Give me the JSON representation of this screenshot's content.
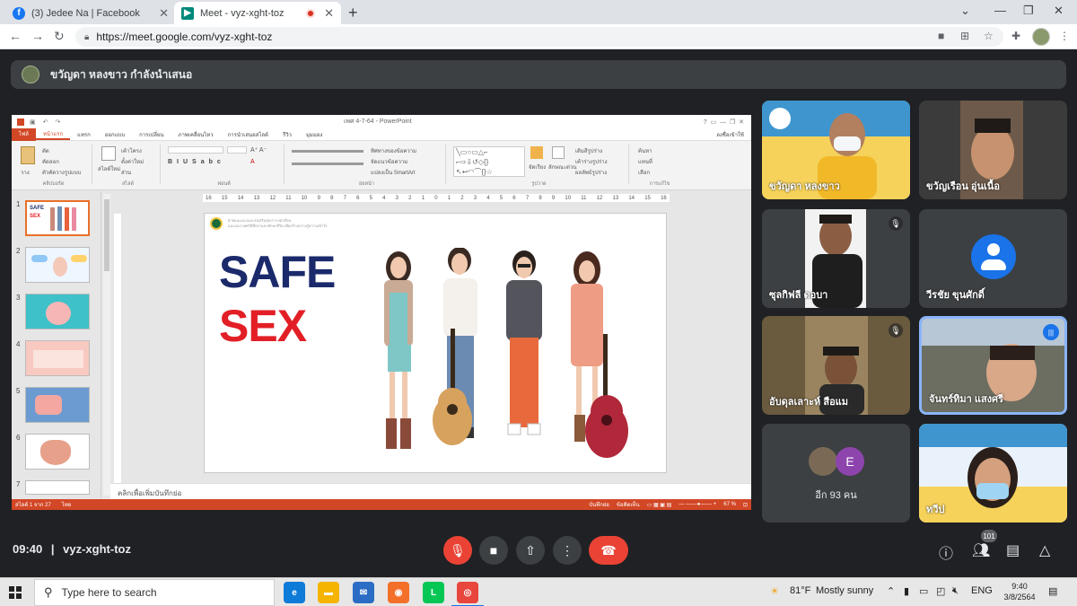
{
  "browser": {
    "tabs": [
      {
        "label": "(3) Jedee Na | Facebook",
        "favicon": "facebook-icon",
        "color": "#1877f2"
      },
      {
        "label": "Meet - vyz-xght-toz",
        "favicon": "meet-icon",
        "color": "#00897b",
        "recording": true
      }
    ],
    "url": "https://meet.google.com/vyz-xght-toz"
  },
  "meet": {
    "presenter_banner": "ขวัญดา หลงขาว กำลังนำเสนอ",
    "time": "09:40",
    "separator": "|",
    "meeting_code": "vyz-xght-toz",
    "participant_count": "101",
    "others_label": "อีก 93 คน",
    "others_avatar_letter": "E",
    "tiles": [
      {
        "name": "ขวัญดา หลงขาว",
        "muted": false
      },
      {
        "name": "ขวัญเรือน อุ่นเนื้อ",
        "muted": false
      },
      {
        "name": "ซุลกิฟลี ดอบา",
        "muted": true
      },
      {
        "name": "วีรชัย ขุนศักดิ์",
        "muted": false
      },
      {
        "name": "อับดุลเลาะห์ สือแม",
        "muted": true
      },
      {
        "name": "จันทร์ทิมา แสงศรี",
        "muted": false,
        "speaking": true
      },
      {
        "name": "ทวีป",
        "muted": false
      }
    ]
  },
  "powerpoint": {
    "doc_title": "เพศ 4-7-64 - PowerPoint",
    "ribbon_tabs": [
      "ไฟล์",
      "หน้าแรก",
      "แทรก",
      "ออกแบบ",
      "การเปลี่ยน",
      "ภาพเคลื่อนไหว",
      "การนำเสนอสไลด์",
      "รีวิว",
      "มุมมอง"
    ],
    "ribbon_right": "ลงชื่อเข้าใช้",
    "groups": [
      "คลิปบอร์ด",
      "สไลด์",
      "ฟอนต์",
      "ย่อหน้า",
      "รูปวาด",
      "การแก้ไข"
    ],
    "ribbon_buttons": {
      "paste": "วาง",
      "cut": "ตัด",
      "copy": "คัดลอก",
      "format_painter": "ตัวคัดวางรูปแบบ",
      "new_slide": "สไลด์ใหม่",
      "layout": "เค้าโครง",
      "reset": "ตั้งค่าใหม่",
      "section": "ส่วน",
      "text_direction": "ทิศทางของข้อความ",
      "align_text": "จัดแนวข้อความ",
      "smartart": "แปลงเป็น SmartArt",
      "arrange": "จัดเรียง",
      "quick_styles": "ลักษณะด่วน",
      "shape_fill": "เติมสีรูปร่าง",
      "shape_outline": "เค้าร่างรูปร่าง",
      "shape_effects": "ผลลัพธ์รูปร่าง",
      "find": "ค้นหา",
      "replace": "แทนที่",
      "select": "เลือก"
    },
    "ruler_ticks": [
      "16",
      "15",
      "14",
      "13",
      "12",
      "11",
      "10",
      "9",
      "8",
      "7",
      "6",
      "5",
      "4",
      "3",
      "2",
      "1",
      "0",
      "1",
      "2",
      "3",
      "4",
      "5",
      "6",
      "7",
      "8",
      "9",
      "10",
      "11",
      "12",
      "13",
      "14",
      "15",
      "16"
    ],
    "slide_numbers": [
      "1",
      "2",
      "3",
      "4",
      "5",
      "6",
      "7"
    ],
    "slide": {
      "header_line1": "ฝ่ายแนะแนวและส่งเสริมสุขภาวะนักเรียน",
      "header_line2": "แนะแนว เพศวิถีศึกษาและทักษะชีวิต เพื่อสร้างความรู้ความเข้าใจ",
      "word1": "SAFE",
      "word2": "SEX"
    },
    "notes_placeholder": "คลิกเพื่อเพิ่มบันทึกย่อ",
    "status_left": "สไลด์ 1 จาก 27",
    "status_lang": "ไทย",
    "status_notes": "บันทึกย่อ",
    "status_comments": "ข้อคิดเห็น",
    "zoom": "67 %"
  },
  "taskbar": {
    "search_placeholder": "Type here to search",
    "weather_temp": "81°F",
    "weather_text": "Mostly sunny",
    "lang": "ENG",
    "time": "9:40",
    "date": "3/8/2564"
  },
  "colors": {
    "meet_bg": "#202124",
    "ppt_accent": "#d24726",
    "end_call": "#ea4335",
    "safe_blue": "#1b2a6b",
    "sex_red": "#e21f26"
  }
}
